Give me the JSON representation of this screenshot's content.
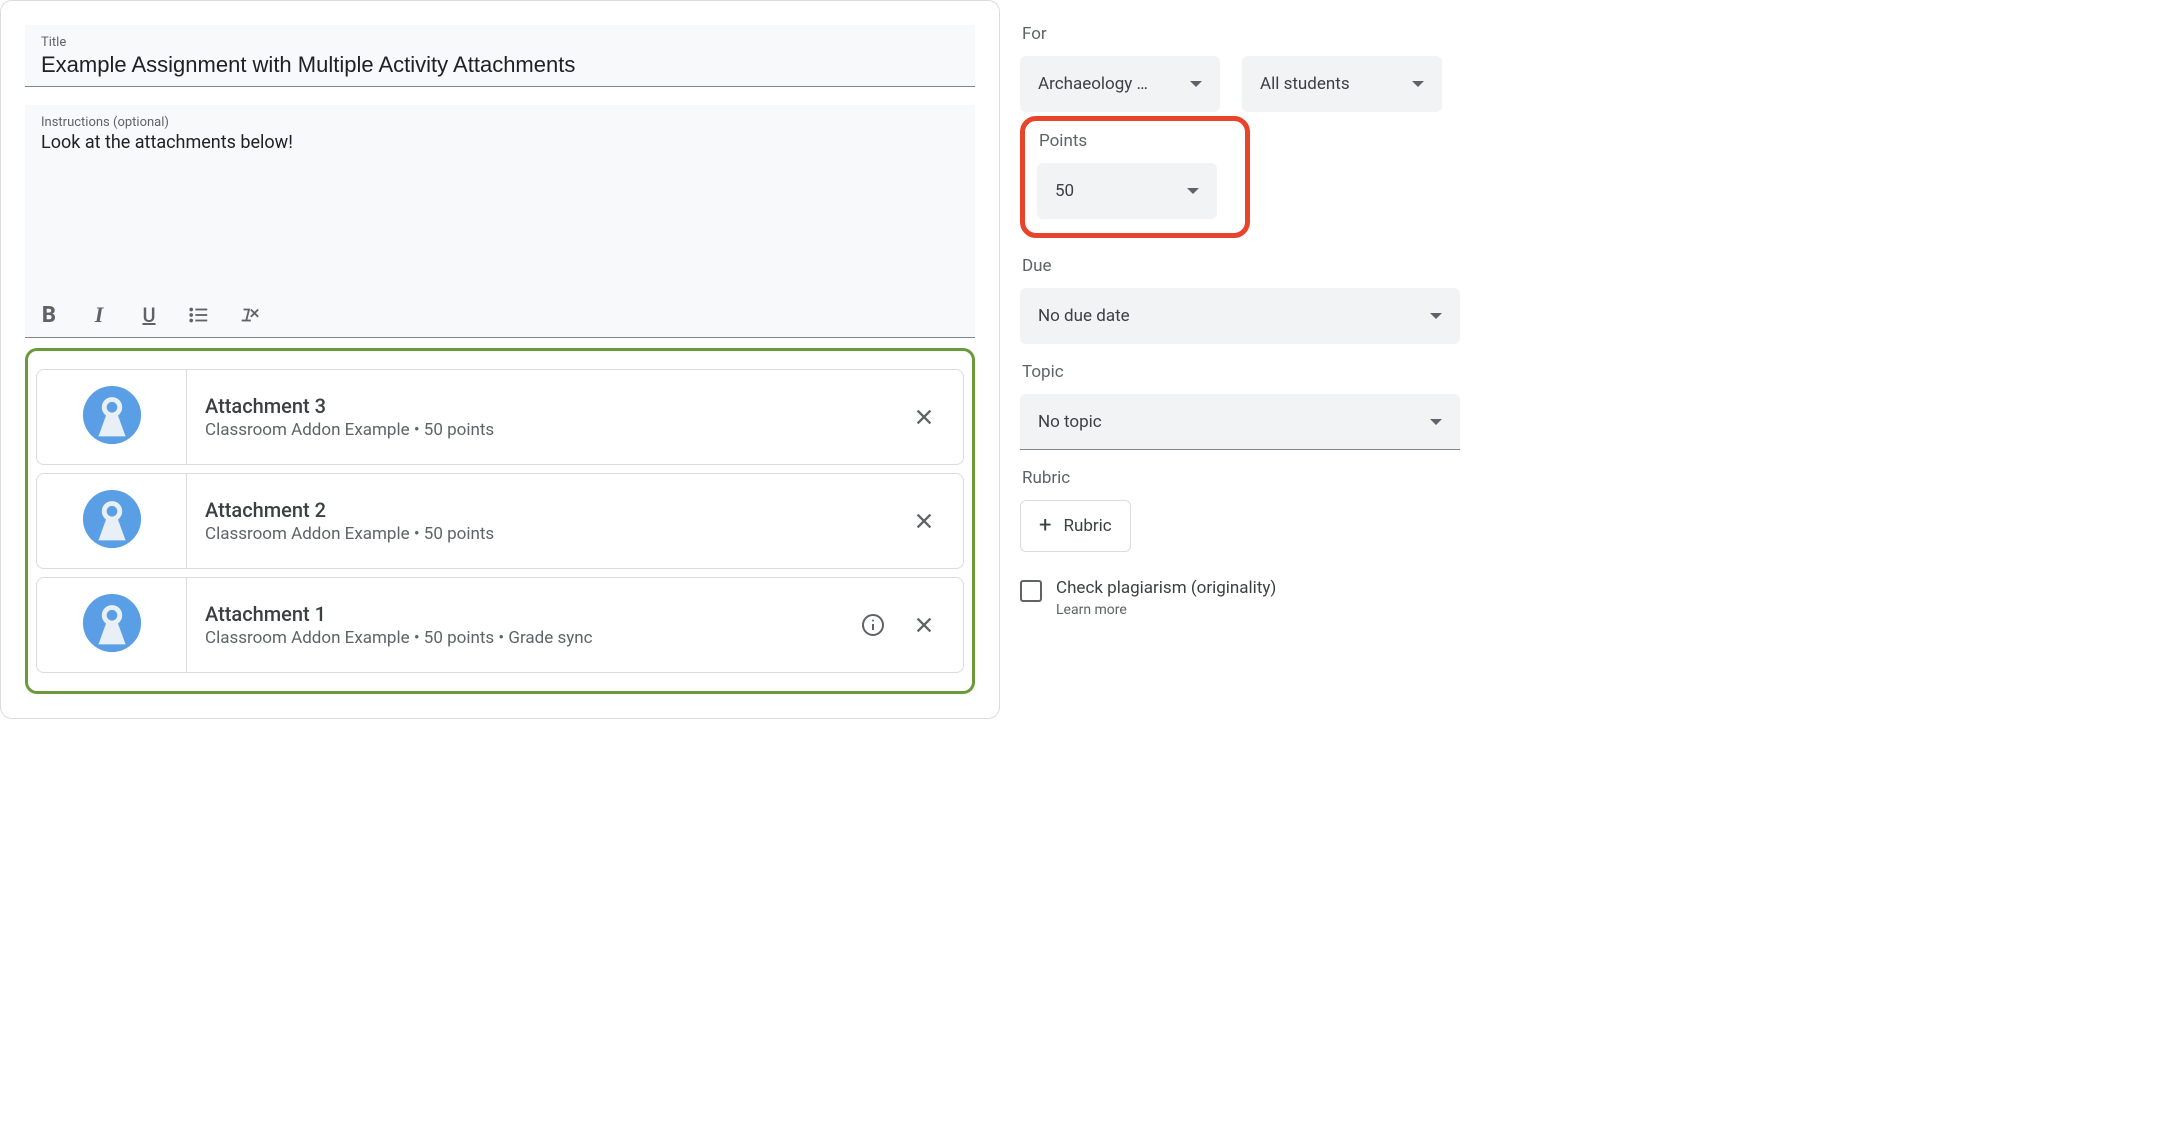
{
  "title_field": {
    "label": "Title",
    "value": "Example Assignment with Multiple Activity Attachments"
  },
  "instructions_field": {
    "label": "Instructions (optional)",
    "value": "Look at the attachments below!"
  },
  "attachments": [
    {
      "title": "Attachment 3",
      "subtitle": "Classroom Addon Example • 50 points",
      "has_info": false
    },
    {
      "title": "Attachment 2",
      "subtitle": "Classroom Addon Example • 50 points",
      "has_info": false
    },
    {
      "title": "Attachment 1",
      "subtitle": "Classroom Addon Example • 50 points • Grade sync",
      "has_info": true
    }
  ],
  "sidebar": {
    "for_label": "For",
    "class_value": "Archaeology …",
    "students_value": "All students",
    "points_label": "Points",
    "points_value": "50",
    "due_label": "Due",
    "due_value": "No due date",
    "topic_label": "Topic",
    "topic_value": "No topic",
    "rubric_label": "Rubric",
    "rubric_button": "Rubric",
    "plagiarism_label": "Check plagiarism (originality)",
    "learn_more": "Learn more"
  }
}
